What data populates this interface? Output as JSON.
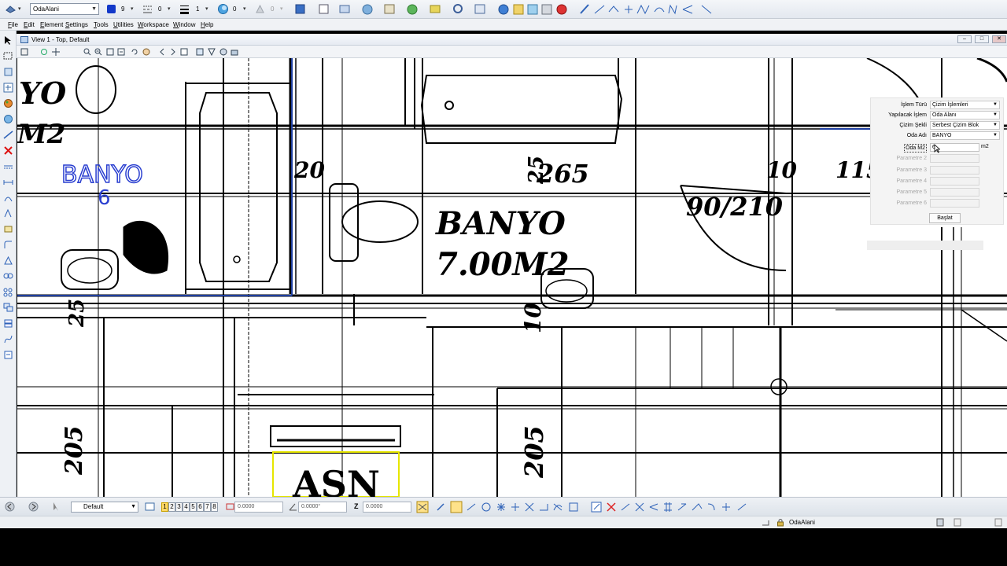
{
  "toolbar": {
    "level_combo": "OdaAlani",
    "color_value": "9",
    "style_value": "0",
    "weight_value": "1",
    "transparency_value": "0",
    "priority_value": "0"
  },
  "menu": {
    "items": [
      "File",
      "Edit",
      "Element",
      "Settings",
      "Tools",
      "Utilities",
      "Workspace",
      "Window",
      "Help"
    ]
  },
  "view": {
    "title": "View 1 - Top, Default",
    "min_label": "–",
    "restore_label": "□",
    "close_label": "✕"
  },
  "drawing": {
    "texts": {
      "yo": "YO",
      "m2_partial": "M2",
      "banyo_blue": "BANYO",
      "blue_6": "6",
      "dim_20": "20",
      "dim_265": "265",
      "dim_25": "25",
      "banyo_label": "BANYO",
      "area_label": "7.00M2",
      "dim_10": "10",
      "dim_115": "115",
      "door_dim": "90/210",
      "dim_205_left": "205",
      "dim_205_mid": "205",
      "asn": "ASN"
    }
  },
  "panel": {
    "rows": [
      {
        "label": "İşlem Türü",
        "value": "Çizim İşlemleri",
        "kind": "select"
      },
      {
        "label": "Yapılacak İşlem",
        "value": "Oda Alanı",
        "kind": "select"
      },
      {
        "label": "Çizim Şekli",
        "value": "Serbest Çizim Blok",
        "kind": "select"
      },
      {
        "label": "Oda Adı",
        "value": "BANYO",
        "kind": "select"
      },
      {
        "label": "Oda M2",
        "value": "6",
        "kind": "input",
        "unit": "m2"
      },
      {
        "label": "Parametre 2",
        "value": "",
        "kind": "disabled"
      },
      {
        "label": "Parametre 3",
        "value": "",
        "kind": "disabled"
      },
      {
        "label": "Parametre 4",
        "value": "",
        "kind": "disabled"
      },
      {
        "label": "Parametre 5",
        "value": "",
        "kind": "disabled"
      },
      {
        "label": "Parametre 6",
        "value": "",
        "kind": "disabled"
      }
    ],
    "button_label": "Başlat"
  },
  "bottombar": {
    "model_combo": "Default",
    "view_numbers": [
      "1",
      "2",
      "3",
      "4",
      "5",
      "6",
      "7",
      "8"
    ],
    "x_value": "0.0000",
    "angle_value": "0.0000°",
    "z_label": "Z",
    "z_value": "0.0000"
  },
  "status": {
    "active_level": "OdaAlani"
  },
  "colors": {
    "accent_blue": "#1f3fa0",
    "drawing_blue": "#2a3fd0",
    "selection_yellow": "#e6e600"
  }
}
